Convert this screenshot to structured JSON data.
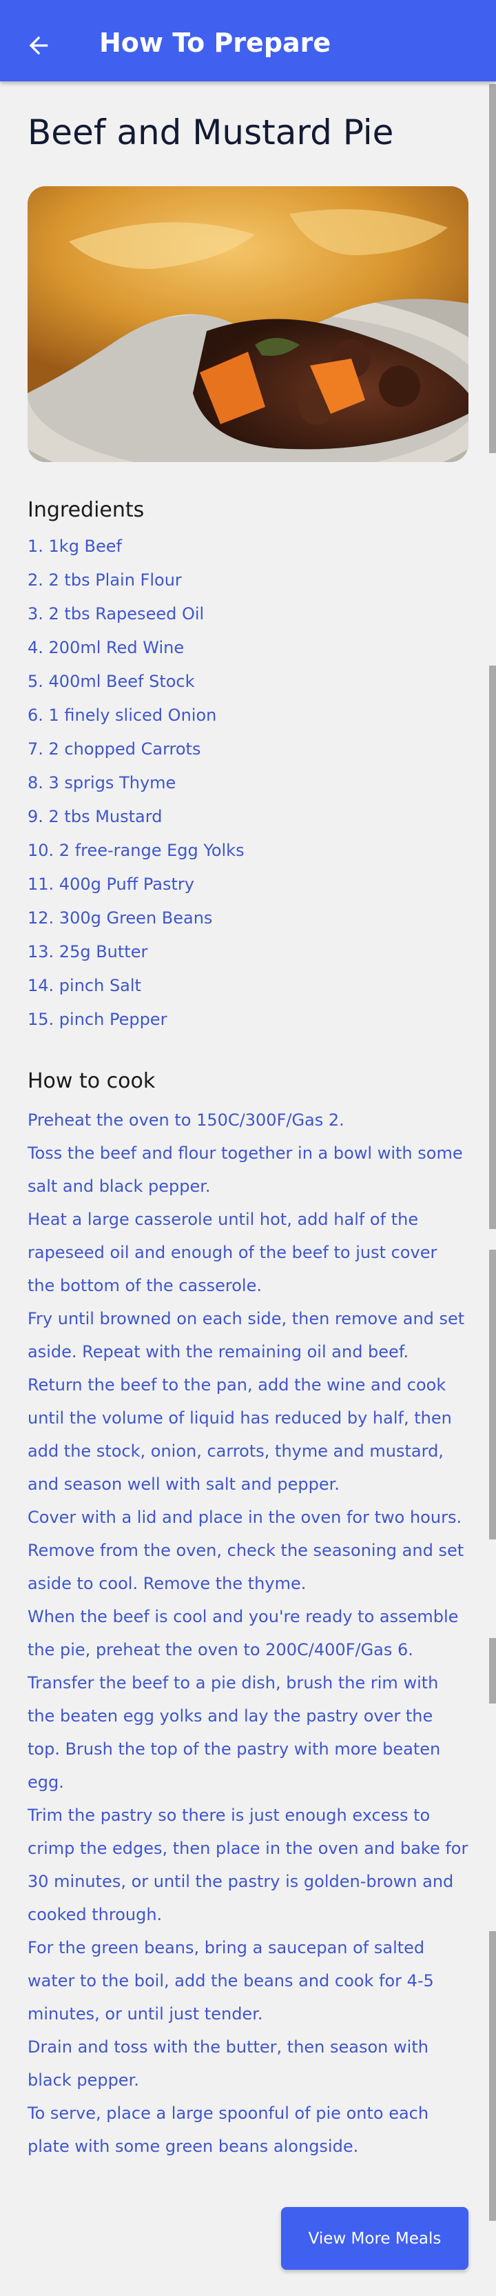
{
  "appbar": {
    "title": "How To Prepare",
    "back_icon": "arrow-left-icon"
  },
  "recipe": {
    "title": "Beef and Mustard Pie",
    "image_icon": "beef-pie-photo"
  },
  "ingredients": {
    "heading": "Ingredients",
    "items": [
      "1. 1kg Beef",
      "2. 2 tbs Plain Flour",
      "3. 2 tbs Rapeseed Oil",
      "4. 200ml Red Wine",
      "5. 400ml Beef Stock",
      "6. 1 finely sliced Onion",
      "7. 2 chopped Carrots",
      "8. 3 sprigs Thyme",
      "9. 2 tbs Mustard",
      "10. 2 free-range Egg Yolks",
      "11. 400g Puff Pastry",
      "12. 300g Green Beans",
      "13. 25g Butter",
      "14. pinch Salt",
      "15. pinch Pepper"
    ]
  },
  "instructions": {
    "heading": "How to cook",
    "steps": [
      "Preheat the oven to 150C/300F/Gas 2.",
      "Toss the beef and flour together in a bowl with some salt and black pepper.",
      "Heat a large casserole until hot, add half of the rapeseed oil and enough of the beef to just cover the bottom of the casserole.",
      "Fry until browned on each side, then remove and set aside. Repeat with the remaining oil and beef.",
      "Return the beef to the pan, add the wine and cook until the volume of liquid has reduced by half, then add the stock, onion, carrots, thyme and mustard, and season well with salt and pepper.",
      "Cover with a lid and place in the oven for two hours.",
      "Remove from the oven, check the seasoning and set aside to cool. Remove the thyme.",
      "When the beef is cool and you're ready to assemble the pie, preheat the oven to 200C/400F/Gas 6.",
      "Transfer the beef to a pie dish, brush the rim with the beaten egg yolks and lay the pastry over the top. Brush the top of the pastry with more beaten egg.",
      "Trim the pastry so there is just enough excess to crimp the edges, then place in the oven and bake for 30 minutes, or until the pastry is golden-brown and cooked through.",
      "For the green beans, bring a saucepan of salted water to the boil, add the beans and cook for 4-5 minutes, or until just tender.",
      "Drain and toss with the butter, then season with black pepper.",
      "To serve, place a large spoonful of pie onto each plate with some green beans alongside."
    ]
  },
  "footer": {
    "more_button_label": "View More Meals"
  },
  "colors": {
    "primary": "#4060f0",
    "link_text": "#3f56cc",
    "background": "#f1f1f1",
    "title_text": "#131a33"
  }
}
